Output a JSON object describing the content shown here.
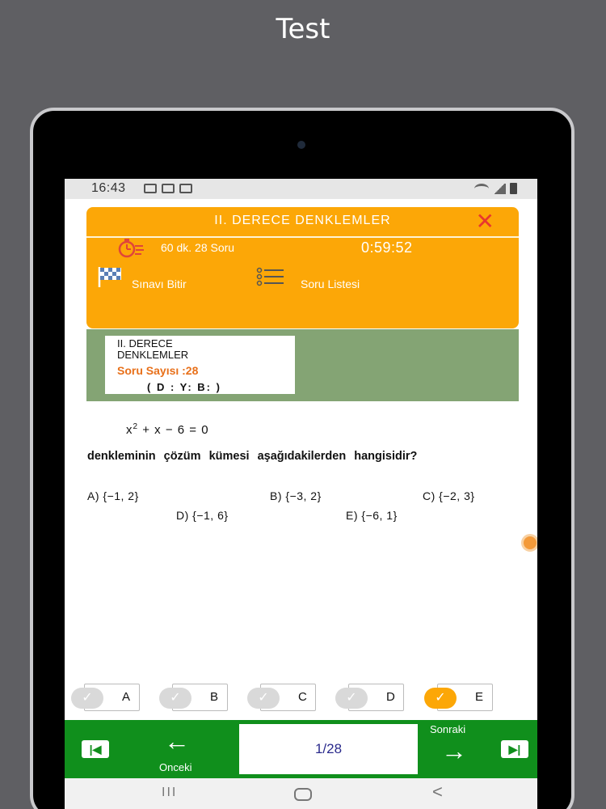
{
  "page": {
    "title": "Test"
  },
  "status_bar": {
    "time": "16:43"
  },
  "header": {
    "title": "II. DERECE DENKLEMLER",
    "close": "✕",
    "duration": "60 dk. 28 Soru",
    "countdown": "0:59:52",
    "finish_label": "Sınavı Bitir",
    "list_label": "Soru Listesi"
  },
  "info_card": {
    "topic": "II. DERECE DENKLEMLER",
    "count": "Soru Sayısı :28",
    "dyb": "( D :  Y:  B: )"
  },
  "question": {
    "text": "denkleminin çözüm kümesi aşağıdakilerden hangisidir?",
    "options": [
      {
        "letter": "A)",
        "value": "{−1, 2}"
      },
      {
        "letter": "B)",
        "value": "{−3, 2}"
      },
      {
        "letter": "C)",
        "value": "{−2, 3}"
      },
      {
        "letter": "D)",
        "value": "{−1, 6}"
      },
      {
        "letter": "E)",
        "value": "{−6, 1}"
      }
    ]
  },
  "answers": {
    "letters": [
      "A",
      "B",
      "C",
      "D",
      "E"
    ],
    "selected": "E",
    "check_glyph": "✓"
  },
  "navigation": {
    "first": "|◀",
    "last": "▶|",
    "prev_arrow": "←",
    "prev_label": "Onceki",
    "next_arrow": "→",
    "next_label": "Sonraki",
    "page_indicator": "1/28"
  },
  "system_nav": {
    "recent": "III",
    "back": "<"
  },
  "colors": {
    "header_orange": "#fca707",
    "info_green": "#84a474",
    "nav_green": "#108f1c",
    "count_orange": "#e8701a",
    "close_red": "#e8372e"
  }
}
